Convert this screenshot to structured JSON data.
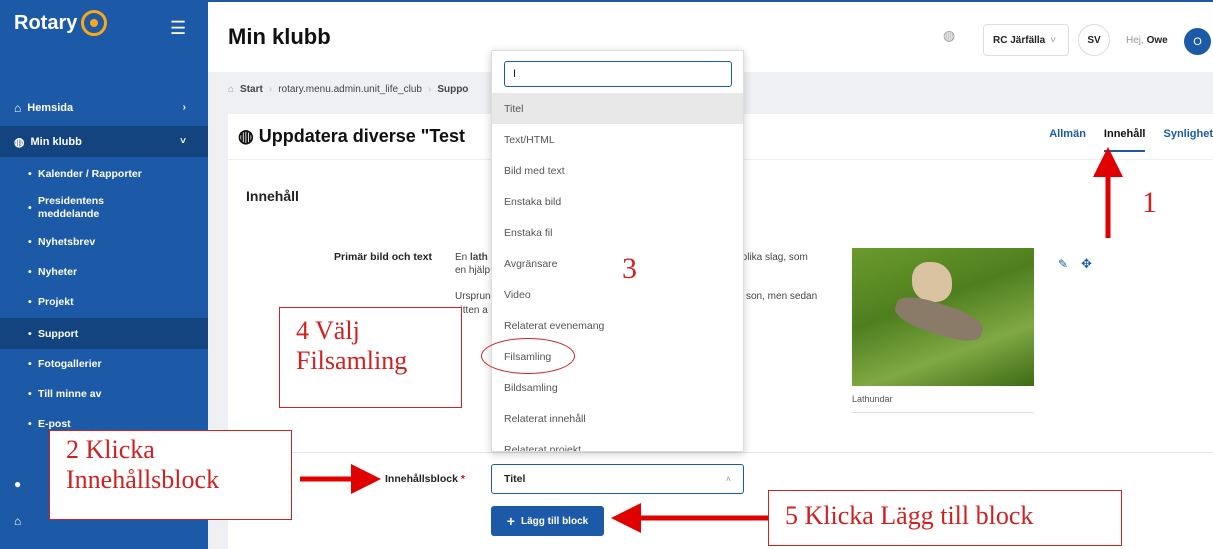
{
  "sidebar": {
    "logo": "Rotary",
    "items": [
      {
        "label": "Hemsida",
        "icon": "home-icon"
      },
      {
        "label": "Min klubb",
        "icon": "globe-icon"
      },
      {
        "label": "Kalender / Rapporter"
      },
      {
        "label": "Presidentens meddelande"
      },
      {
        "label": "Nyhetsbrev"
      },
      {
        "label": "Nyheter"
      },
      {
        "label": "Projekt"
      },
      {
        "label": "Support"
      },
      {
        "label": "Fotogallerier"
      },
      {
        "label": "Till minne av"
      },
      {
        "label": "E-post"
      }
    ]
  },
  "header": {
    "title": "Min klubb",
    "club": "RC Järfälla",
    "lang": "SV",
    "greeting": "Hej,",
    "user": "Owe",
    "avatar": "O"
  },
  "breadcrumb": [
    "Start",
    "rotary.menu.admin.unit_life_club",
    "Suppo"
  ],
  "card": {
    "title": "Uppdatera diverse \"Test",
    "tabs": [
      "Allmän",
      "Innehåll",
      "Synlighet"
    ],
    "section": "Innehåll",
    "field_label": "Primär bild och text",
    "desc_l1a": "En",
    "desc_l1b": "lath",
    "desc_l1c": "e av olika slag, som",
    "desc_l2": "en hjälp",
    "desc_l3a": "Ursprun",
    "desc_l3b": "son, men sedan",
    "desc_l4": "nitten a",
    "photo_caption": "Lathundar",
    "block_label": "Innehållsblock",
    "block_required": "*",
    "block_value": "Titel",
    "add_button": "Lägg till block"
  },
  "dropdown": {
    "search_value": "I",
    "items": [
      "Titel",
      "Text/HTML",
      "Bild med text",
      "Enstaka bild",
      "Enstaka fil",
      "Avgränsare",
      "Video",
      "Relaterat evenemang",
      "Filsamling",
      "Bildsamling",
      "Relaterat innehåll",
      "Relaterat projekt"
    ]
  },
  "annotations": {
    "a1": "1",
    "a2_l1": "2 Klicka",
    "a2_l2": "Innehållsblock",
    "a3": "3",
    "a4_l1": "4 Välj",
    "a4_l2": "Filsamling",
    "a5": "5 Klicka Lägg till block"
  }
}
